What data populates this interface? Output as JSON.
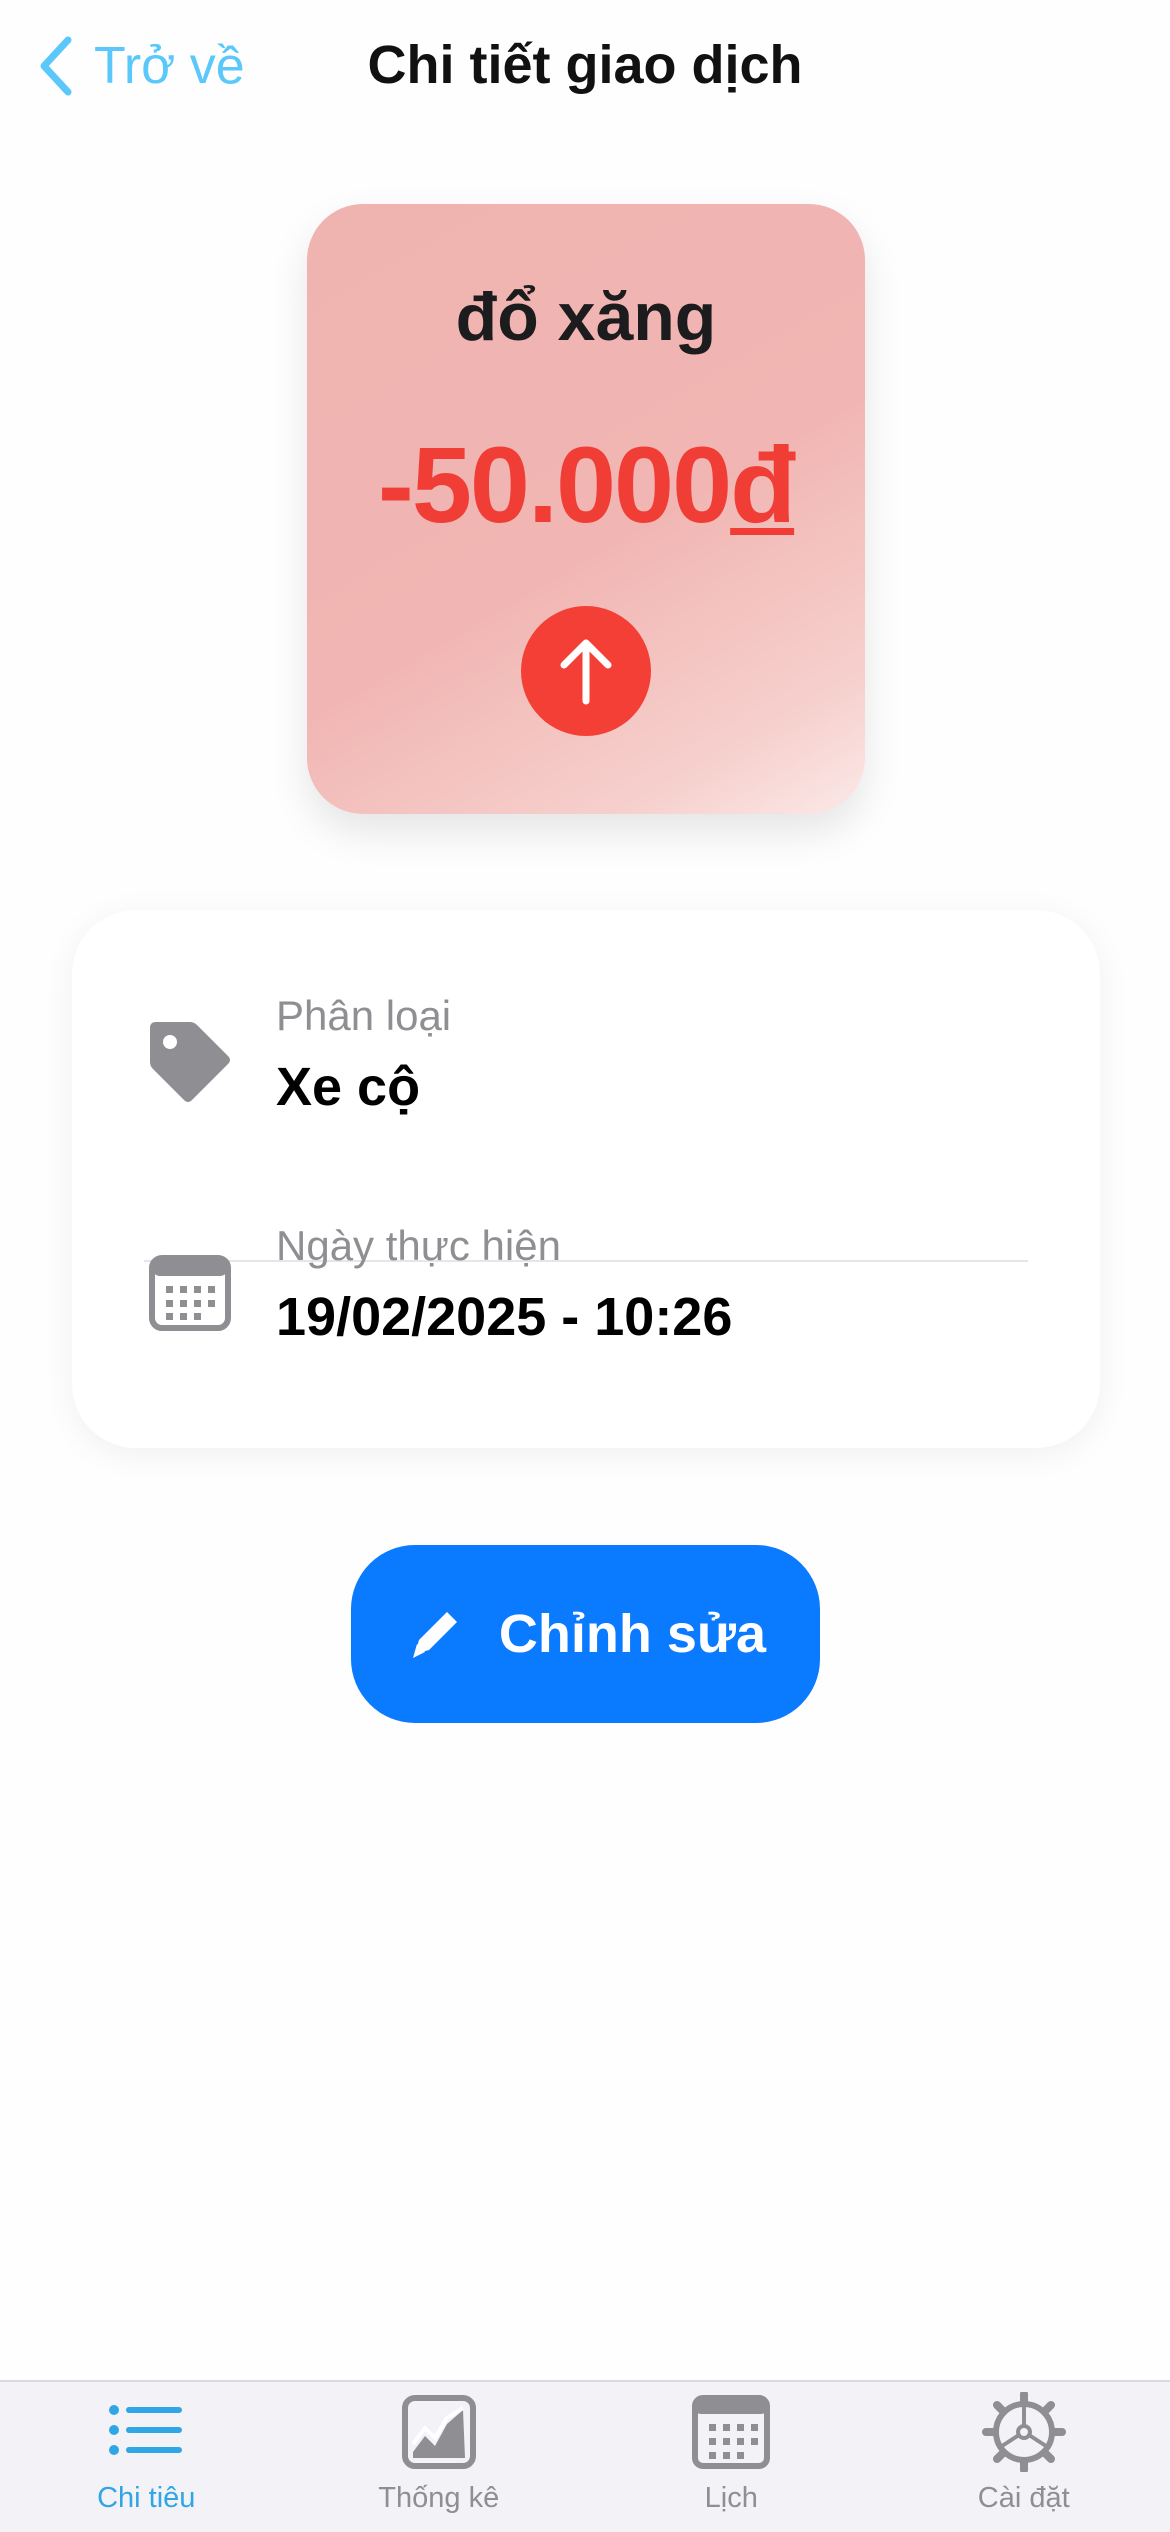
{
  "header": {
    "back_label": "Trở về",
    "title": "Chi tiết giao dịch"
  },
  "summary": {
    "name": "đổ xăng",
    "amount": "-50.000",
    "currency": "đ",
    "type_icon": "arrow-up-icon",
    "color_amount": "#f03e36",
    "color_badge": "#f43f36"
  },
  "details": {
    "category": {
      "icon": "tag-icon",
      "label": "Phân loại",
      "value": "Xe cộ"
    },
    "date": {
      "icon": "calendar-icon",
      "label": "Ngày thực hiện",
      "value": "19/02/2025 - 10:26"
    }
  },
  "edit_button": {
    "icon": "pencil-icon",
    "label": "Chỉnh sửa",
    "color": "#0a7aff"
  },
  "tab_bar": {
    "active_color": "#30a6e6",
    "inactive_color": "#8e8e93",
    "tabs": [
      {
        "label": "Chi tiêu",
        "icon": "list-icon",
        "active": true
      },
      {
        "label": "Thống kê",
        "icon": "chart-icon",
        "active": false
      },
      {
        "label": "Lịch",
        "icon": "calendar-icon",
        "active": false
      },
      {
        "label": "Cài đặt",
        "icon": "gear-icon",
        "active": false
      }
    ]
  }
}
